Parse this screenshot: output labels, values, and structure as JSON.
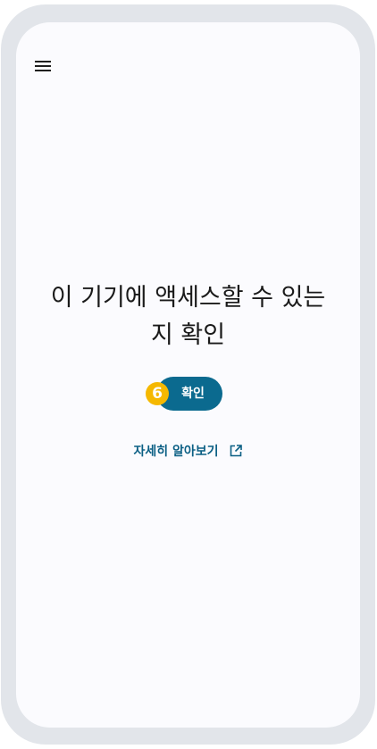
{
  "header": {
    "menu_icon": "hamburger-menu-icon"
  },
  "main": {
    "heading_line1": "이 기기에 액세스할 수 있는",
    "heading_line2": "지 확인",
    "step_badge": "6",
    "confirm_label": "확인",
    "learn_more_label": "자세히 알아보기",
    "learn_more_icon": "external-link-icon"
  },
  "colors": {
    "frame": "#e2e5ea",
    "screen_background": "#fbfbfe",
    "primary_button": "#0b6a8f",
    "link": "#0b5f84",
    "badge": "#f5b800"
  }
}
